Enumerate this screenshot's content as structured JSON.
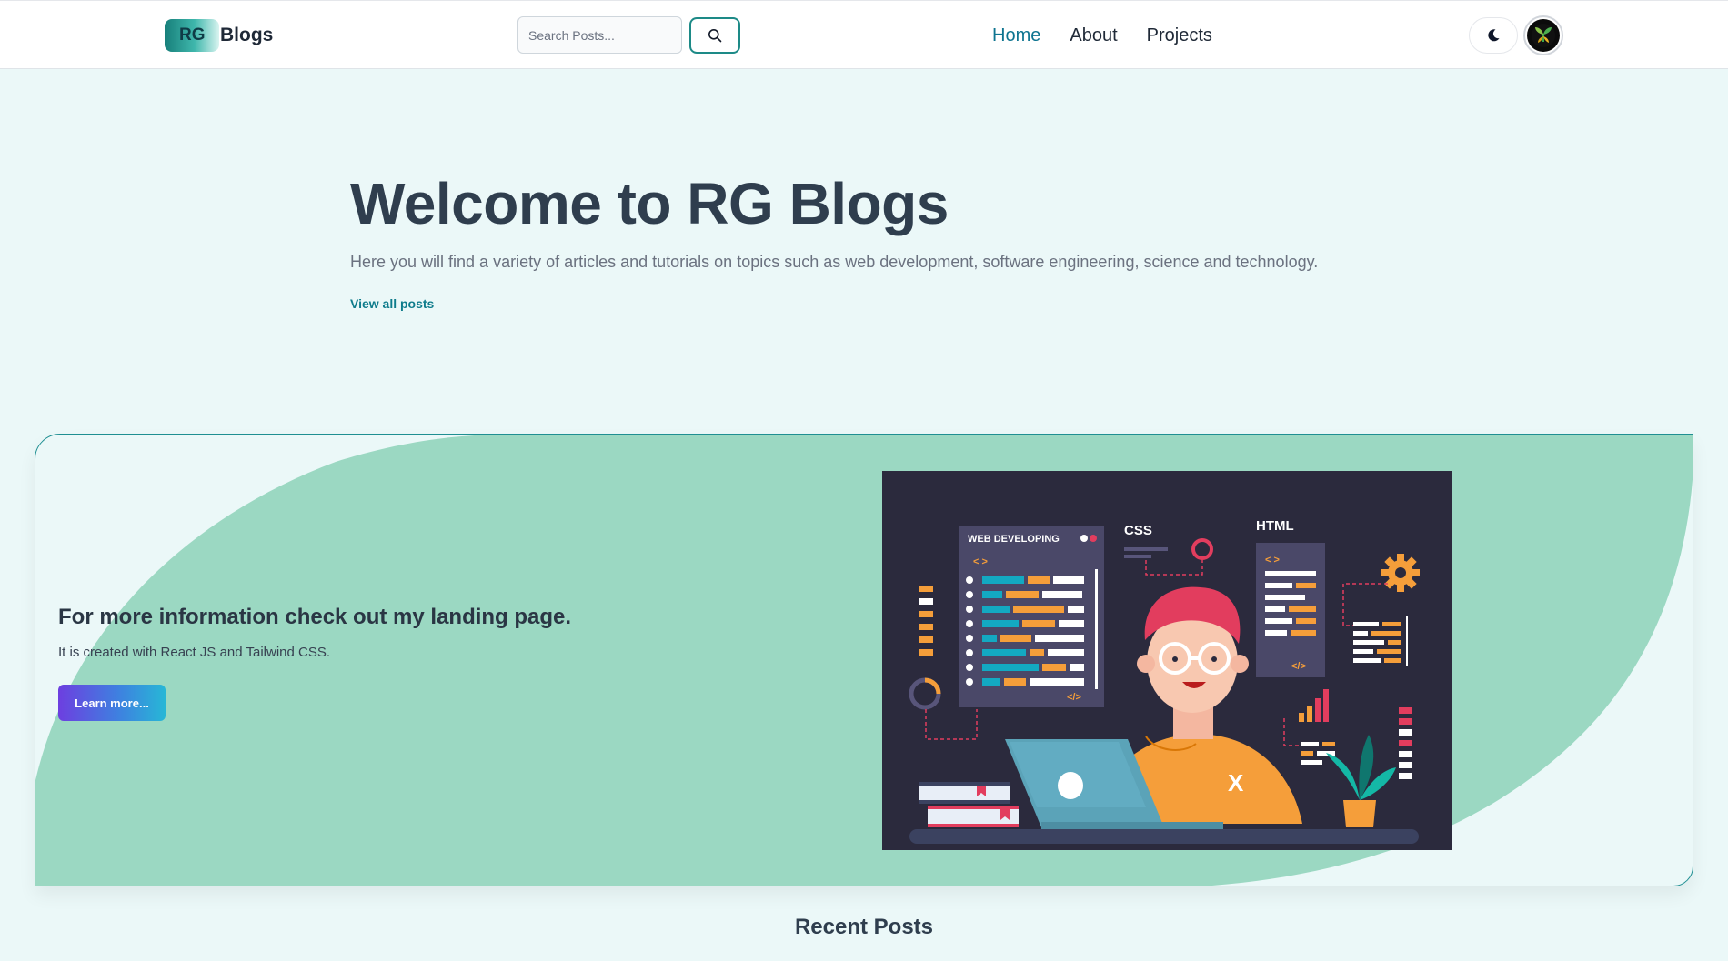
{
  "header": {
    "logo_badge": "RG",
    "logo_text": "Blogs",
    "search": {
      "placeholder": "Search Posts...",
      "value": ""
    },
    "nav": [
      {
        "label": "Home",
        "active": true
      },
      {
        "label": "About",
        "active": false
      },
      {
        "label": "Projects",
        "active": false
      }
    ],
    "icons": {
      "search": "search-icon",
      "theme": "moon-icon",
      "avatar": "profile-avatar"
    }
  },
  "hero": {
    "title": "Welcome to RG Blogs",
    "subtitle": "Here you will find a variety of articles and tutorials on topics such as web development, software engineering, science and technology.",
    "link": "View all posts"
  },
  "callout": {
    "title": "For more information check out my landing page.",
    "description": "It is created with React JS and Tailwind CSS.",
    "button": "Learn more...",
    "illustration": {
      "panel_title": "WEB DEVELOPING",
      "css_label": "CSS",
      "html_label": "HTML",
      "code_tags": "< >",
      "close_tags": "</>",
      "shirt_mark": "X"
    }
  },
  "recent": {
    "title": "Recent Posts"
  },
  "colors": {
    "accent": "#0e7490",
    "brand_teal": "#1d8a87",
    "page_bg": "#ebf8f8",
    "callout_shape": "#9bd8c2",
    "illustration_bg": "#2b2a3d"
  }
}
